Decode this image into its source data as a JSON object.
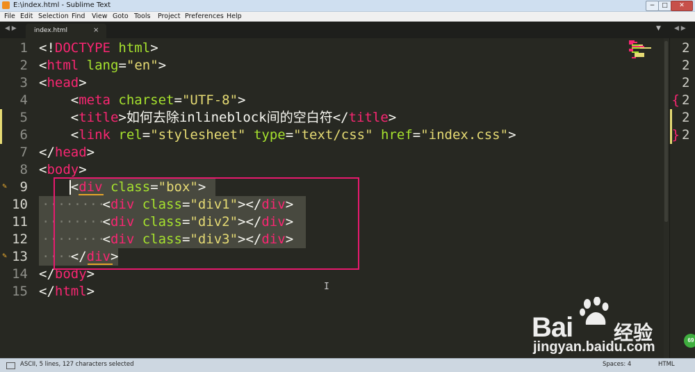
{
  "window": {
    "title": "E:\\index.html - Sublime Text",
    "min_glyph": "−",
    "max_glyph": "□",
    "close_glyph": "✕"
  },
  "menu": [
    "File",
    "Edit",
    "Selection",
    "Find",
    "View",
    "Goto",
    "Tools",
    "Project",
    "Preferences",
    "Help"
  ],
  "tabs": {
    "nav_arrows": "◀ ▶",
    "active_tab": "index.html",
    "close_glyph": "×",
    "dropdown_glyph": "▼",
    "pane_arrows": "◀ ▶"
  },
  "editor": {
    "line_numbers": [
      "1",
      "2",
      "3",
      "4",
      "5",
      "6",
      "7",
      "8",
      "9",
      "10",
      "11",
      "12",
      "13",
      "14",
      "15"
    ],
    "lines": [
      [
        [
          "t",
          "<!"
        ],
        [
          "tag",
          "DOCTYPE"
        ],
        [
          "t",
          " "
        ],
        [
          "attr",
          "html"
        ],
        [
          "t",
          ">"
        ]
      ],
      [
        [
          "t",
          "<"
        ],
        [
          "tag",
          "html"
        ],
        [
          "t",
          " "
        ],
        [
          "attr",
          "lang"
        ],
        [
          "t",
          "="
        ],
        [
          "str",
          "\"en\""
        ],
        [
          "t",
          ">"
        ]
      ],
      [
        [
          "t",
          "<"
        ],
        [
          "tag",
          "head"
        ],
        [
          "t",
          ">"
        ]
      ],
      [
        [
          "t",
          "    <"
        ],
        [
          "tag",
          "meta"
        ],
        [
          "t",
          " "
        ],
        [
          "attr",
          "charset"
        ],
        [
          "t",
          "="
        ],
        [
          "str",
          "\"UTF-8\""
        ],
        [
          "t",
          ">"
        ]
      ],
      [
        [
          "t",
          "    <"
        ],
        [
          "tag",
          "title"
        ],
        [
          "t",
          ">"
        ],
        [
          "txt",
          "如何去除inlineblock间的空白符"
        ],
        [
          "t",
          "</"
        ],
        [
          "tag",
          "title"
        ],
        [
          "t",
          ">"
        ]
      ],
      [
        [
          "t",
          "    <"
        ],
        [
          "tag",
          "link"
        ],
        [
          "t",
          " "
        ],
        [
          "attr",
          "rel"
        ],
        [
          "t",
          "="
        ],
        [
          "str",
          "\"stylesheet\""
        ],
        [
          "t",
          " "
        ],
        [
          "attr",
          "type"
        ],
        [
          "t",
          "="
        ],
        [
          "str",
          "\"text/css\""
        ],
        [
          "t",
          " "
        ],
        [
          "attr",
          "href"
        ],
        [
          "t",
          "="
        ],
        [
          "str",
          "\"index.css\""
        ],
        [
          "t",
          ">"
        ]
      ],
      [
        [
          "t",
          "</"
        ],
        [
          "tag",
          "head"
        ],
        [
          "t",
          ">"
        ]
      ],
      [
        [
          "t",
          "<"
        ],
        [
          "tag",
          "body"
        ],
        [
          "t",
          ">"
        ]
      ],
      [
        [
          "t",
          "    <"
        ],
        [
          "tag",
          "div"
        ],
        [
          "t",
          " "
        ],
        [
          "attr",
          "class"
        ],
        [
          "t",
          "="
        ],
        [
          "str",
          "\"box\""
        ],
        [
          "t",
          ">"
        ]
      ],
      [
        [
          "t",
          "        <"
        ],
        [
          "tag",
          "div"
        ],
        [
          "t",
          " "
        ],
        [
          "attr",
          "class"
        ],
        [
          "t",
          "="
        ],
        [
          "str",
          "\"div1\""
        ],
        [
          "t",
          "></"
        ],
        [
          "tag",
          "div"
        ],
        [
          "t",
          ">"
        ]
      ],
      [
        [
          "t",
          "        <"
        ],
        [
          "tag",
          "div"
        ],
        [
          "t",
          " "
        ],
        [
          "attr",
          "class"
        ],
        [
          "t",
          "="
        ],
        [
          "str",
          "\"div2\""
        ],
        [
          "t",
          "></"
        ],
        [
          "tag",
          "div"
        ],
        [
          "t",
          ">"
        ]
      ],
      [
        [
          "t",
          "        <"
        ],
        [
          "tag",
          "div"
        ],
        [
          "t",
          " "
        ],
        [
          "attr",
          "class"
        ],
        [
          "t",
          "="
        ],
        [
          "str",
          "\"div3\""
        ],
        [
          "t",
          "></"
        ],
        [
          "tag",
          "div"
        ],
        [
          "t",
          ">"
        ]
      ],
      [
        [
          "t",
          "    </"
        ],
        [
          "tag",
          "div"
        ],
        [
          "t",
          ">"
        ]
      ],
      [
        [
          "t",
          "</"
        ],
        [
          "tag",
          "body"
        ],
        [
          "t",
          ">"
        ]
      ],
      [
        [
          "t",
          "</"
        ],
        [
          "tag",
          "html"
        ],
        [
          "t",
          ">"
        ]
      ]
    ],
    "selected_lines": [
      9,
      10,
      11,
      12,
      13
    ],
    "modified_lines": [
      5,
      6
    ],
    "bookmarked_lines": [
      9,
      13
    ]
  },
  "right_pane": {
    "lines": [
      {
        "mark": "",
        "text": "2"
      },
      {
        "mark": "",
        "text": "2"
      },
      {
        "mark": "",
        "text": "2"
      },
      {
        "mark": "{",
        "text": "2"
      },
      {
        "mark": "",
        "text": "2"
      },
      {
        "mark": "}",
        "text": "2"
      }
    ]
  },
  "watermark": {
    "brand": "Bai",
    "brand_cn": "经验",
    "domain": "jingyan.baidu.com",
    "badge": "69"
  },
  "status_bar": {
    "text": "ASCII, 5 lines, 127 characters selected",
    "spaces": "Spaces: 4",
    "syntax": "HTML"
  },
  "colors": {
    "tag": "#f92672",
    "attribute": "#a6e22e",
    "string": "#e6db74",
    "text": "#f8f8f2",
    "background": "#272822",
    "annotation_box": "#e8196e"
  }
}
